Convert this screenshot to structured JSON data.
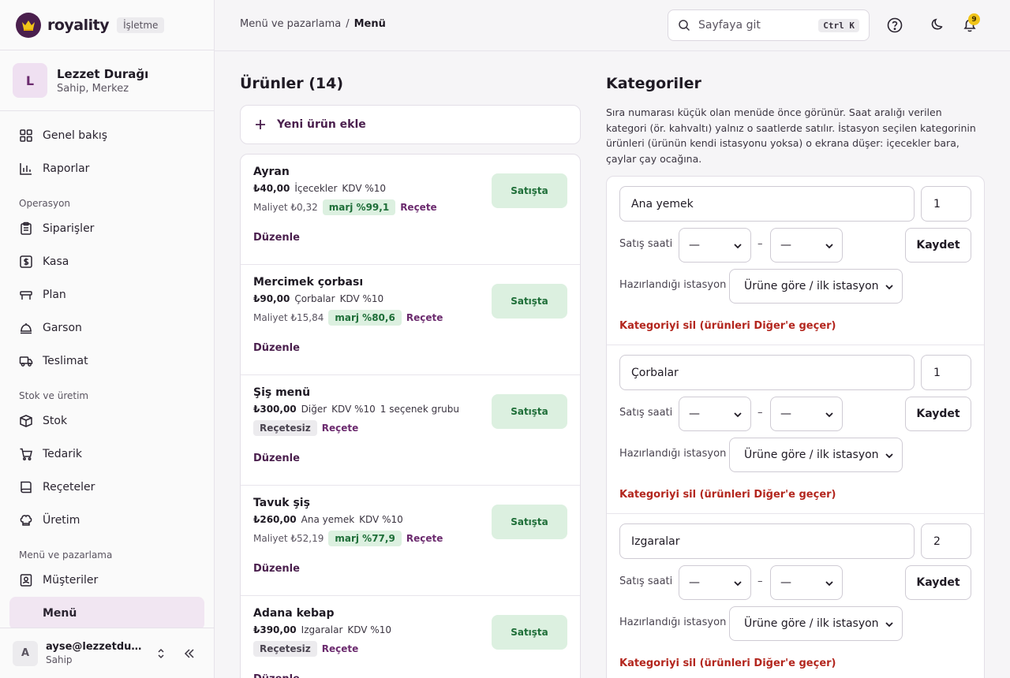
{
  "brand": {
    "name": "royality",
    "badge": "İşletme"
  },
  "account": {
    "initial": "L",
    "name": "Lezzet Durağı",
    "role": "Sahip, Merkez"
  },
  "nav": {
    "top": [
      {
        "label": "Genel bakış",
        "icon": "grid-icon"
      },
      {
        "label": "Raporlar",
        "icon": "bar-chart-icon"
      }
    ],
    "sections": [
      {
        "title": "Operasyon",
        "items": [
          {
            "label": "Siparişler",
            "icon": "clipboard-icon"
          },
          {
            "label": "Kasa",
            "icon": "cash-register-icon"
          },
          {
            "label": "Plan",
            "icon": "floor-plan-icon"
          },
          {
            "label": "Garson",
            "icon": "waiter-icon"
          },
          {
            "label": "Teslimat",
            "icon": "truck-icon"
          }
        ]
      },
      {
        "title": "Stok ve üretim",
        "items": [
          {
            "label": "Stok",
            "icon": "box-icon"
          },
          {
            "label": "Tedarik",
            "icon": "cart-icon"
          },
          {
            "label": "Reçeteler",
            "icon": "book-icon"
          },
          {
            "label": "Üretim",
            "icon": "chef-hat-icon"
          }
        ]
      },
      {
        "title": "Menü ve pazarlama",
        "items": [
          {
            "label": "Müşteriler",
            "icon": "contact-icon"
          },
          {
            "label": "Menü",
            "icon": "menu-icon",
            "active": true
          }
        ]
      }
    ]
  },
  "user": {
    "initial": "A",
    "email": "ayse@lezzetduragi.com",
    "role": "Sahip"
  },
  "topbar": {
    "breadcrumb": [
      "Menü ve pazarlama",
      "Menü"
    ],
    "search_placeholder": "Sayfaya git",
    "shortcut": "Ctrl K",
    "notification_count": "9"
  },
  "products": {
    "title": "Ürünler (14)",
    "add_label": "Yeni ürün ekle",
    "edit_label": "Düzenle",
    "recipe_label": "Reçete",
    "items": [
      {
        "name": "Ayran",
        "price": "₺40,00",
        "category": "İçecekler",
        "tax": "KDV %10",
        "extra": "",
        "cost": "Maliyet ₺0,32",
        "margin": "marj %99,1",
        "no_recipe": "",
        "status": "Satışta"
      },
      {
        "name": "Mercimek çorbası",
        "price": "₺90,00",
        "category": "Çorbalar",
        "tax": "KDV %10",
        "extra": "",
        "cost": "Maliyet ₺15,84",
        "margin": "marj %80,6",
        "no_recipe": "",
        "status": "Satışta"
      },
      {
        "name": "Şiş menü",
        "price": "₺300,00",
        "category": "Diğer",
        "tax": "KDV %10",
        "extra": "1 seçenek grubu",
        "cost": "",
        "margin": "",
        "no_recipe": "Reçetesiz",
        "status": "Satışta"
      },
      {
        "name": "Tavuk şiş",
        "price": "₺260,00",
        "category": "Ana yemek",
        "tax": "KDV %10",
        "extra": "",
        "cost": "Maliyet ₺52,19",
        "margin": "marj %77,9",
        "no_recipe": "",
        "status": "Satışta"
      },
      {
        "name": "Adana kebap",
        "price": "₺390,00",
        "category": "Izgaralar",
        "tax": "KDV %10",
        "extra": "",
        "cost": "",
        "margin": "",
        "no_recipe": "Reçetesiz",
        "status": "Satışta"
      }
    ]
  },
  "categories": {
    "title": "Kategoriler",
    "description": "Sıra numarası küçük olan menüde önce görünür. Saat aralığı verilen kategori (ör. kahvaltı) yalnız o saatlerde satılır. İstasyon seçilen kategorinin ürünleri (ürünün kendi istasyonu yoksa) o ekrana düşer: içecekler bara, çaylar çay ocağına.",
    "hours_label": "Satış saati",
    "station_label": "Hazırlandığı istasyon",
    "save_label": "Kaydet",
    "delete_label": "Kategoriyi sil (ürünleri Diğer'e geçer)",
    "time_empty": "—",
    "station_default": "Ürüne göre / ilk istasyon",
    "items": [
      {
        "name": "Ana yemek",
        "order": "1"
      },
      {
        "name": "Çorbalar",
        "order": "1"
      },
      {
        "name": "Izgaralar",
        "order": "2"
      }
    ]
  }
}
